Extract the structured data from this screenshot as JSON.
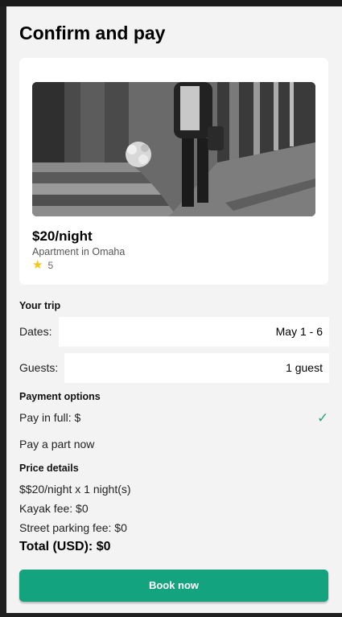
{
  "page": {
    "title": "Confirm and pay"
  },
  "listing": {
    "price": "$20/night",
    "type": "Apartment in Omaha",
    "rating": "5",
    "photo_icon": "street-photo"
  },
  "trip": {
    "heading": "Your trip",
    "dates_label": "Dates:",
    "dates_value": "May 1 - 6",
    "guests_label": "Guests:",
    "guests_value": "1 guest"
  },
  "payment": {
    "heading": "Payment options",
    "full_label": "Pay in full: $",
    "part_label": "Pay a part now",
    "selected": "full",
    "check_icon": "checkmark-icon"
  },
  "price_details": {
    "heading": "Price details",
    "nightly": "$$20/night x 1 night(s)",
    "kayak_fee": "Kayak fee: $0",
    "parking_fee": "Street parking fee: $0",
    "total": "Total (USD): $0"
  },
  "actions": {
    "book_label": "Book now"
  },
  "colors": {
    "accent": "#14a37f",
    "check": "#27a27a",
    "star": "#f5c518"
  }
}
